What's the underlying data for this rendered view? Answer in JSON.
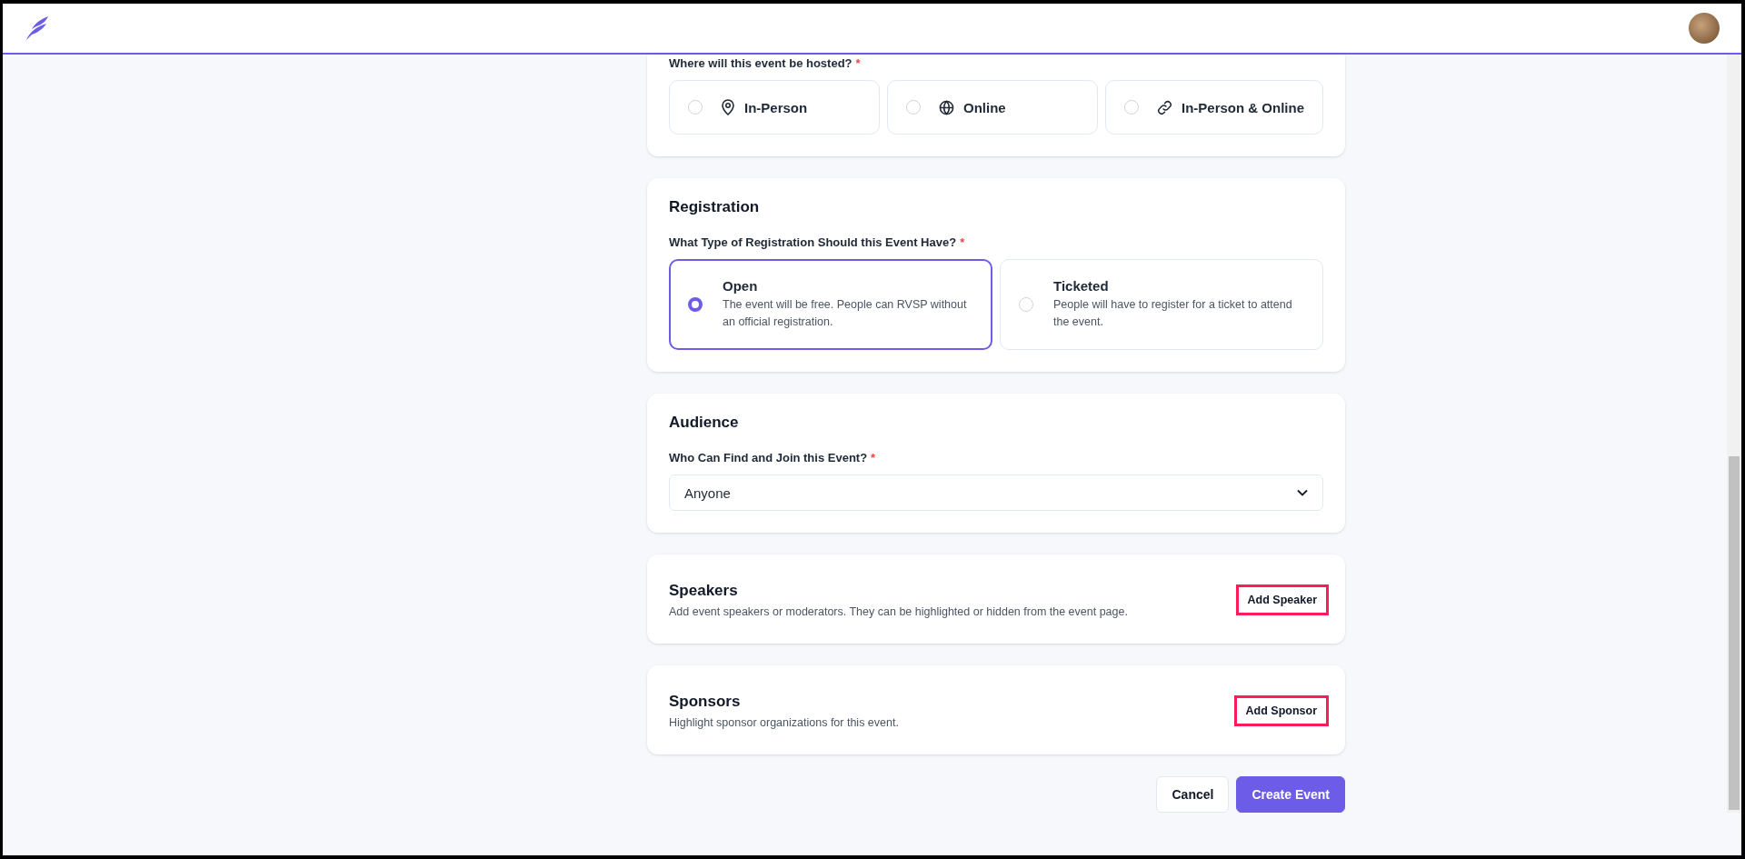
{
  "hosting": {
    "label": "Where will this event be hosted?",
    "required_mark": "*",
    "options": [
      {
        "label": "In-Person",
        "kind": "pin",
        "selected": false
      },
      {
        "label": "Online",
        "kind": "globe",
        "selected": false
      },
      {
        "label": "In-Person & Online",
        "kind": "link",
        "selected": false
      }
    ]
  },
  "registration": {
    "title": "Registration",
    "label": "What Type of Registration Should this Event Have?",
    "required_mark": "*",
    "options": [
      {
        "title": "Open",
        "description": "The event will be free. People can RVSP without an official registration.",
        "selected": true
      },
      {
        "title": "Ticketed",
        "description": "People will have to register for a ticket to attend the event.",
        "selected": false
      }
    ]
  },
  "audience": {
    "title": "Audience",
    "label": "Who Can Find and Join this Event?",
    "required_mark": "*",
    "value": "Anyone"
  },
  "sections": [
    {
      "title": "Speakers",
      "description": "Add event speakers or moderators. They can be highlighted or hidden from the event page.",
      "button": "Add Speaker",
      "highlighted": true
    },
    {
      "title": "Sponsors",
      "description": "Highlight sponsor organizations for this event.",
      "button": "Add Sponsor",
      "highlighted": true
    }
  ],
  "actions": [
    {
      "label": "Cancel",
      "kind": "secondary"
    },
    {
      "label": "Create Event",
      "kind": "primary"
    }
  ]
}
